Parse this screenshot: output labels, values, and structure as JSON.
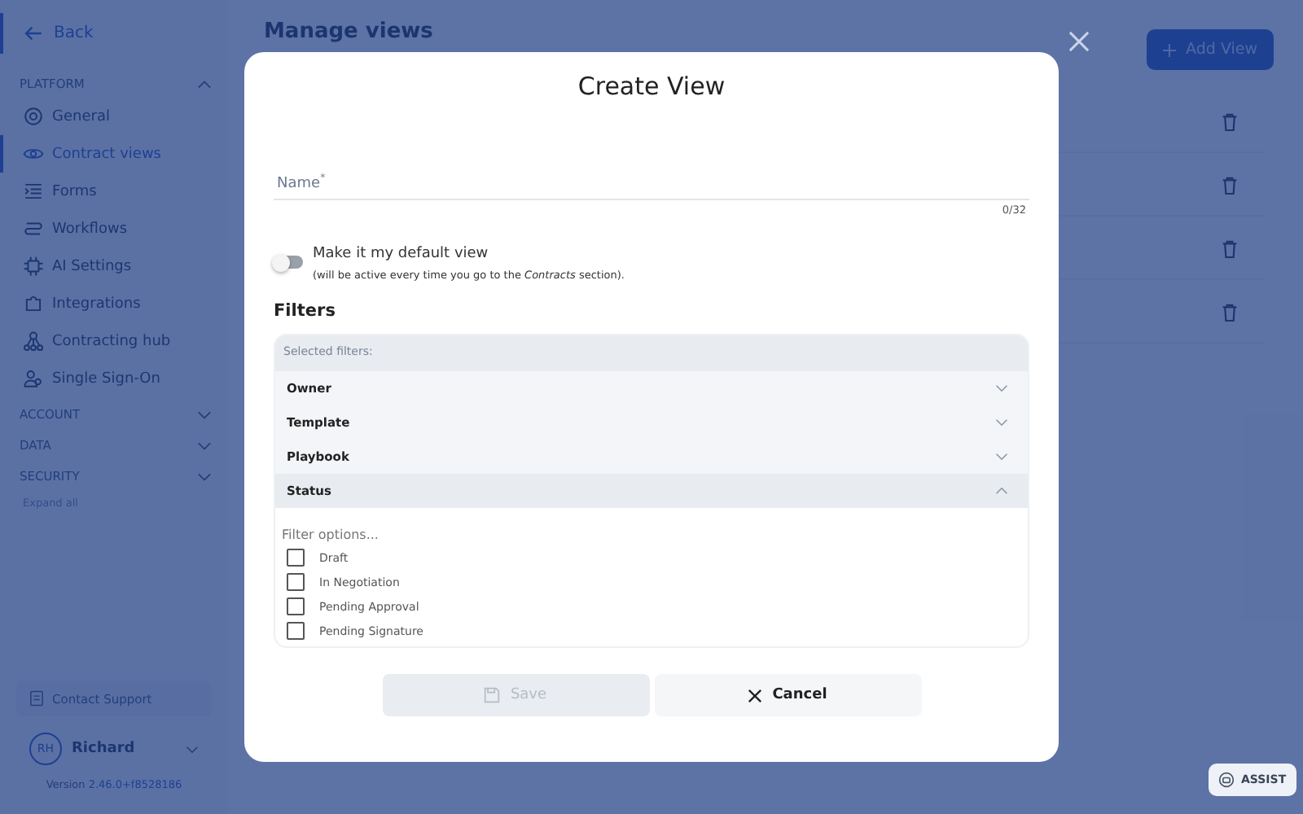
{
  "sidebar": {
    "back": "Back",
    "sections": [
      {
        "title": "PLATFORM",
        "expanded": true,
        "items": [
          {
            "label": "General",
            "selected": false
          },
          {
            "label": "Contract views",
            "selected": true
          },
          {
            "label": "Forms",
            "selected": false
          },
          {
            "label": "Workflows",
            "selected": false
          },
          {
            "label": "AI Settings",
            "selected": false
          },
          {
            "label": "Integrations",
            "selected": false
          },
          {
            "label": "Contracting hub",
            "selected": false
          },
          {
            "label": "Single Sign-On",
            "selected": false
          }
        ]
      },
      {
        "title": "ACCOUNT",
        "expanded": false
      },
      {
        "title": "DATA",
        "expanded": false
      },
      {
        "title": "SECURITY",
        "expanded": false
      }
    ],
    "expand_all": "Expand all",
    "support": "Contact Support",
    "user": {
      "initials": "RH",
      "name": "Richard"
    },
    "version_label": "Version",
    "version": "2.46.0+f8528186"
  },
  "page": {
    "title": "Manage views",
    "add_button": "Add View",
    "view_rows": [
      {
        "deletable": true
      },
      {
        "deletable": true
      },
      {
        "deletable": true
      },
      {
        "deletable": true
      }
    ]
  },
  "modal": {
    "title": "Create View",
    "name_label": "Name",
    "required_mark": "*",
    "counter": "0/32",
    "default_toggle": {
      "label": "Make it my default view",
      "hint": "(will be active every time you go to the *Contracts* section).",
      "on": false
    },
    "filters_heading": "Filters",
    "selected_filters_label": "Selected filters:",
    "groups": [
      {
        "label": "Owner",
        "expanded": false
      },
      {
        "label": "Template",
        "expanded": false
      },
      {
        "label": "Playbook",
        "expanded": false
      },
      {
        "label": "Status",
        "expanded": true,
        "search_placeholder": "Filter options...",
        "options": [
          {
            "label": "Draft",
            "checked": false
          },
          {
            "label": "In Negotiation",
            "checked": false
          },
          {
            "label": "Pending Approval",
            "checked": false
          },
          {
            "label": "Pending Signature",
            "checked": false
          }
        ]
      }
    ],
    "save": {
      "label": "Save",
      "disabled": true
    },
    "cancel": "Cancel"
  },
  "assist": "ASSIST"
}
